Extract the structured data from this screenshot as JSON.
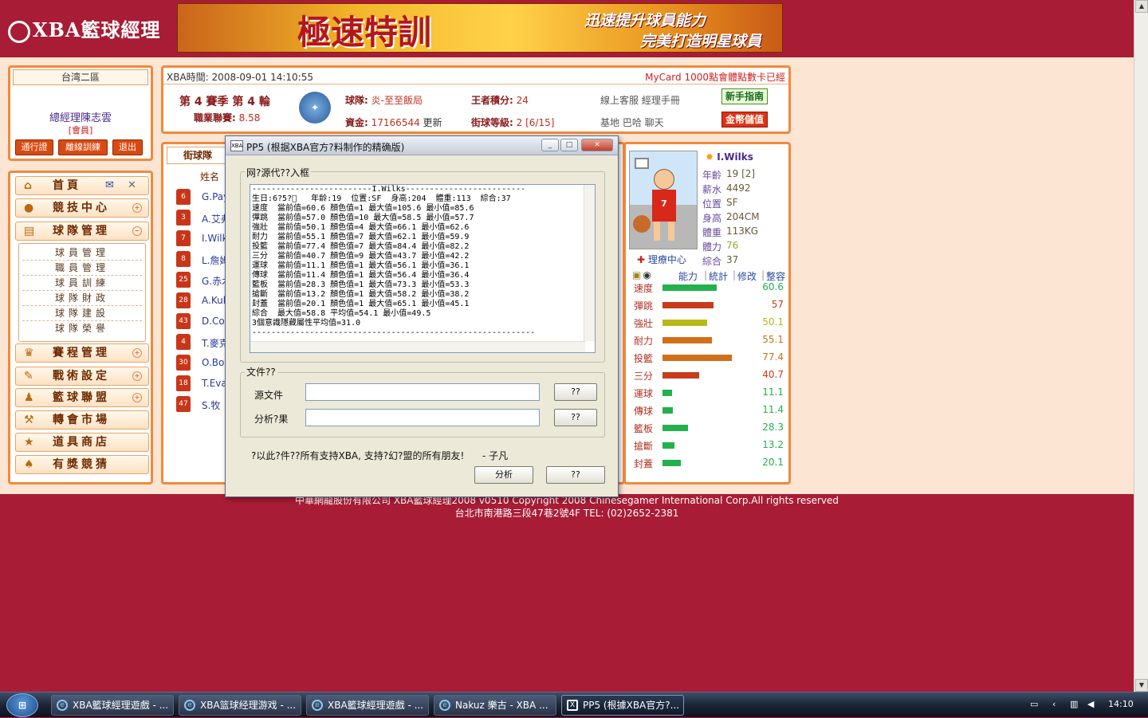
{
  "top": {
    "logo": "XBA籃球經理",
    "banner_main": "極速特訓",
    "banner_sub1": "迅速提升球員能力",
    "banner_sub2": "完美打造明星球員"
  },
  "left": {
    "region": "台湾二區",
    "gm": "總經理陳志雲",
    "member": "[會員]",
    "buttons": [
      "通行證",
      "離線訓練",
      "退出"
    ]
  },
  "menu": {
    "items": [
      {
        "label": "首頁",
        "icon": "home-icon"
      },
      {
        "label": "競技中心",
        "icon": "basketball-icon"
      },
      {
        "label": "球隊管理",
        "icon": "clipboard-icon"
      },
      {
        "label": "賽程管理",
        "icon": "trophy-icon"
      },
      {
        "label": "戰術設定",
        "icon": "tactics-icon"
      },
      {
        "label": "籃球聯盟",
        "icon": "league-icon"
      },
      {
        "label": "轉會市場",
        "icon": "hammer-icon"
      },
      {
        "label": "道具商店",
        "icon": "shop-icon"
      },
      {
        "label": "有獎競猜",
        "icon": "spade-icon"
      }
    ],
    "sub": [
      "球員管理",
      "職員管理",
      "球員訓練",
      "球隊財政",
      "球隊建設",
      "球隊榮譽"
    ]
  },
  "info": {
    "time_label": "XBA時間:",
    "time": "2008-09-01 14:10:55",
    "marquee": "MyCard 1000點會體點數卡已經",
    "season": "第 4 賽季 第 4 輪",
    "league_label": "職業聯賽:",
    "league": "8.58",
    "team_label": "球隊:",
    "team": "炎-至至飯局",
    "king_label": "王者積分:",
    "king": "24",
    "money_label": "資金:",
    "money": "17166544",
    "update": "更新",
    "level_label": "街球等級:",
    "level": "2 [6/15]",
    "links1": "線上客服  經理手冊",
    "links2": "基地  巴哈  聊天",
    "btn_guide": "新手指南",
    "btn_gold": "金幣儲值"
  },
  "team": {
    "tab": "街球隊",
    "col_name": "姓名",
    "players": [
      {
        "no": "6",
        "name": "G.Pay"
      },
      {
        "no": "3",
        "name": "A.艾弗"
      },
      {
        "no": "7",
        "name": "I.Wilk"
      },
      {
        "no": "8",
        "name": "L.詹姆"
      },
      {
        "no": "25",
        "name": "G.赤木"
      },
      {
        "no": "28",
        "name": "A.Kuk"
      },
      {
        "no": "43",
        "name": "D.Co"
      },
      {
        "no": "4",
        "name": "T.麥克"
      },
      {
        "no": "30",
        "name": "O.Bog"
      },
      {
        "no": "18",
        "name": "T.Eva"
      },
      {
        "no": "47",
        "name": "S.牧"
      }
    ]
  },
  "player": {
    "name": "I.Wilks",
    "jersey": "7",
    "rehab": "理療中心",
    "attrs": [
      {
        "label": "年齡",
        "value": "19 [2]"
      },
      {
        "label": "薪水",
        "value": "4492"
      },
      {
        "label": "位置",
        "value": "SF"
      },
      {
        "label": "身高",
        "value": "204CM"
      },
      {
        "label": "體重",
        "value": "113KG"
      },
      {
        "label": "體力",
        "value": "76"
      },
      {
        "label": "綜合",
        "value": "37"
      }
    ],
    "links": [
      "能力",
      "統計",
      "修改",
      "整容"
    ],
    "stats": [
      {
        "label": "速度",
        "value": "60.6",
        "color": "#22b14c"
      },
      {
        "label": "彈跳",
        "value": "57",
        "color": "#c83c1a"
      },
      {
        "label": "強壯",
        "value": "50.1",
        "color": "#b8b81a"
      },
      {
        "label": "耐力",
        "value": "55.1",
        "color": "#d07018"
      },
      {
        "label": "投籃",
        "value": "77.4",
        "color": "#d07018"
      },
      {
        "label": "三分",
        "value": "40.7",
        "color": "#c83c1a"
      },
      {
        "label": "運球",
        "value": "11.1",
        "color": "#22b14c"
      },
      {
        "label": "傳球",
        "value": "11.4",
        "color": "#22b14c"
      },
      {
        "label": "籃板",
        "value": "28.3",
        "color": "#22b14c"
      },
      {
        "label": "搶斷",
        "value": "13.2",
        "color": "#22b14c"
      },
      {
        "label": "封蓋",
        "value": "20.1",
        "color": "#22b14c"
      }
    ]
  },
  "footer": {
    "line1": "中華網龍股份有限公司  XBA籃球經理2008 v0510    Copyright 2008 Chinesegamer International Corp.All rights reserved",
    "line2": "台北市南港路三段47巷2號4F TEL: (02)2652-2381"
  },
  "dialog": {
    "title": "PP5 (根据XBA官方?料制作的精确版)",
    "group1": "网?源代??入框",
    "memo": "-------------------------I.Wilks-------------------------\n生日:6?5?\u0000   年龄:19  位置:SF  身高:204  體重:113  綜合:37\n速度  當前值=60.6 顏色值=1 最大值=105.6 最小值=85.6\n彈跳  當前值=57.0 顏色值=10 最大值=58.5 最小值=57.7\n強壯  當前值=50.1 顏色值=4 最大值=66.1 最小值=62.6\n耐力  當前值=55.1 顏色值=7 最大值=62.1 最小值=59.9\n投籃  當前值=77.4 顏色值=7 最大值=84.4 最小值=82.2\n三分  當前值=40.7 顏色值=9 最大值=43.7 最小值=42.2\n運球  當前值=11.1 顏色值=1 最大值=56.1 最小值=36.1\n傳球  當前值=11.4 顏色值=1 最大值=56.4 最小值=36.4\n籃板  當前值=28.3 顏色值=1 最大值=73.3 最小值=53.3\n搶斷  當前值=13.2 顏色值=1 最大值=58.2 最小值=38.2\n封蓋  當前值=20.1 顏色值=1 最大值=65.1 最小值=45.1\n綜合  最大值=58.8 平均值=54.1 最小值=49.5\n3個意識隱藏屬性平均值=31.0\n-----------------------------------------------------------",
    "group2": "文件??",
    "src_label": "源文件",
    "out_label": "分析?果",
    "browse": "??",
    "note": "?以此?件??所有支持XBA, 支持?幻?盟的所有朋友!",
    "author": "- 子凡",
    "btn_analyze": "分析",
    "btn_close": "??"
  },
  "taskbar": {
    "start": "開始",
    "tasks": [
      "XBA籃球經理遊戲 - ...",
      "XBA篮球经理游戏 - ...",
      "XBA籃球經理遊戲 - ...",
      "Nakuz 樂古 - XBA ...",
      "PP5 (根據XBA官方?..."
    ],
    "clock": "14:10"
  }
}
